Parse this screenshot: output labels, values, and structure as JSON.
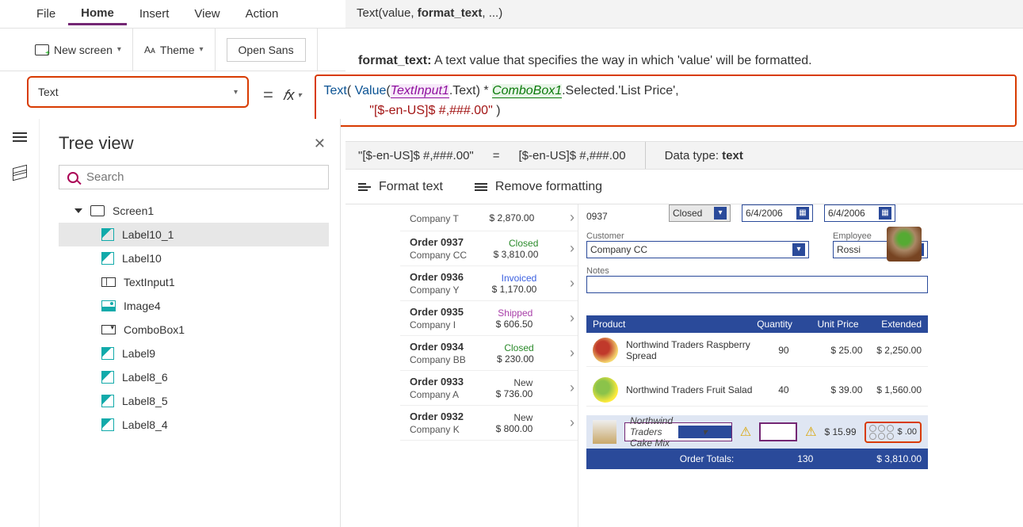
{
  "menu": {
    "file": "File",
    "home": "Home",
    "insert": "Insert",
    "view": "View",
    "action": "Action"
  },
  "ribbon": {
    "new_screen": "New screen",
    "theme": "Theme",
    "font": "Open Sans"
  },
  "fntip": {
    "sig_pre": "Text(value, ",
    "sig_bold": "format_text",
    "sig_post": ", ...)"
  },
  "fnhelp": {
    "label": "format_text:",
    "desc": "A text value that specifies the way in which 'value' will be formatted."
  },
  "property": {
    "name": "Text"
  },
  "formula": {
    "fn": "Text",
    "val": "Value",
    "id1": "TextInput1",
    "dot1": ".Text) * ",
    "id2": "ComboBox1",
    "dot2": ".Selected.'List Price',",
    "str": "\"[$-en-US]$ #,###.00\"",
    "close": " )"
  },
  "result": {
    "lhs": "\"[$-en-US]$ #,###.00\"",
    "eq": "=",
    "rhs": "[$-en-US]$ #,###.00",
    "type_label": "Data type:",
    "type": "text"
  },
  "fmtbar": {
    "format": "Format text",
    "remove": "Remove formatting"
  },
  "tree": {
    "title": "Tree view",
    "search_ph": "Search",
    "screen": "Screen1",
    "items": [
      {
        "label": "Label10_1",
        "icon": "pen"
      },
      {
        "label": "Label10",
        "icon": "pen"
      },
      {
        "label": "TextInput1",
        "icon": "txtin"
      },
      {
        "label": "Image4",
        "icon": "img"
      },
      {
        "label": "ComboBox1",
        "icon": "combo"
      },
      {
        "label": "Label9",
        "icon": "pen"
      },
      {
        "label": "Label8_6",
        "icon": "pen"
      },
      {
        "label": "Label8_5",
        "icon": "pen"
      },
      {
        "label": "Label8_4",
        "icon": "pen"
      }
    ]
  },
  "orders": [
    {
      "title": "",
      "company": "Company T",
      "status": "",
      "price": "$ 2,870.00"
    },
    {
      "title": "Order 0937",
      "company": "Company CC",
      "status": "Closed",
      "price": "$ 3,810.00"
    },
    {
      "title": "Order 0936",
      "company": "Company Y",
      "status": "Invoiced",
      "price": "$ 1,170.00"
    },
    {
      "title": "Order 0935",
      "company": "Company I",
      "status": "Shipped",
      "price": "$ 606.50"
    },
    {
      "title": "Order 0934",
      "company": "Company BB",
      "status": "Closed",
      "price": "$ 230.00"
    },
    {
      "title": "Order 0933",
      "company": "Company A",
      "status": "New",
      "price": "$ 736.00"
    },
    {
      "title": "Order 0932",
      "company": "Company K",
      "status": "New",
      "price": "$ 800.00"
    }
  ],
  "form": {
    "orderid": "0937",
    "status": "Closed",
    "date1": "6/4/2006",
    "date2": "6/4/2006",
    "cust_lbl": "Customer",
    "cust": "Company CC",
    "emp_lbl": "Employee",
    "emp": "Rossi",
    "notes_lbl": "Notes"
  },
  "prod_header": {
    "p": "Product",
    "q": "Quantity",
    "u": "Unit Price",
    "e": "Extended"
  },
  "products": [
    {
      "name": "Northwind Traders Raspberry Spread",
      "q": "90",
      "u": "$ 25.00",
      "e": "$ 2,250.00"
    },
    {
      "name": "Northwind Traders Fruit Salad",
      "q": "40",
      "u": "$ 39.00",
      "e": "$ 1,560.00"
    }
  ],
  "newrow": {
    "combo": "Northwind Traders Cake Mix",
    "price": "$ 15.99",
    "ext": "$ .00"
  },
  "totals": {
    "label": "Order Totals:",
    "qty": "130",
    "sum": "$ 3,810.00"
  }
}
